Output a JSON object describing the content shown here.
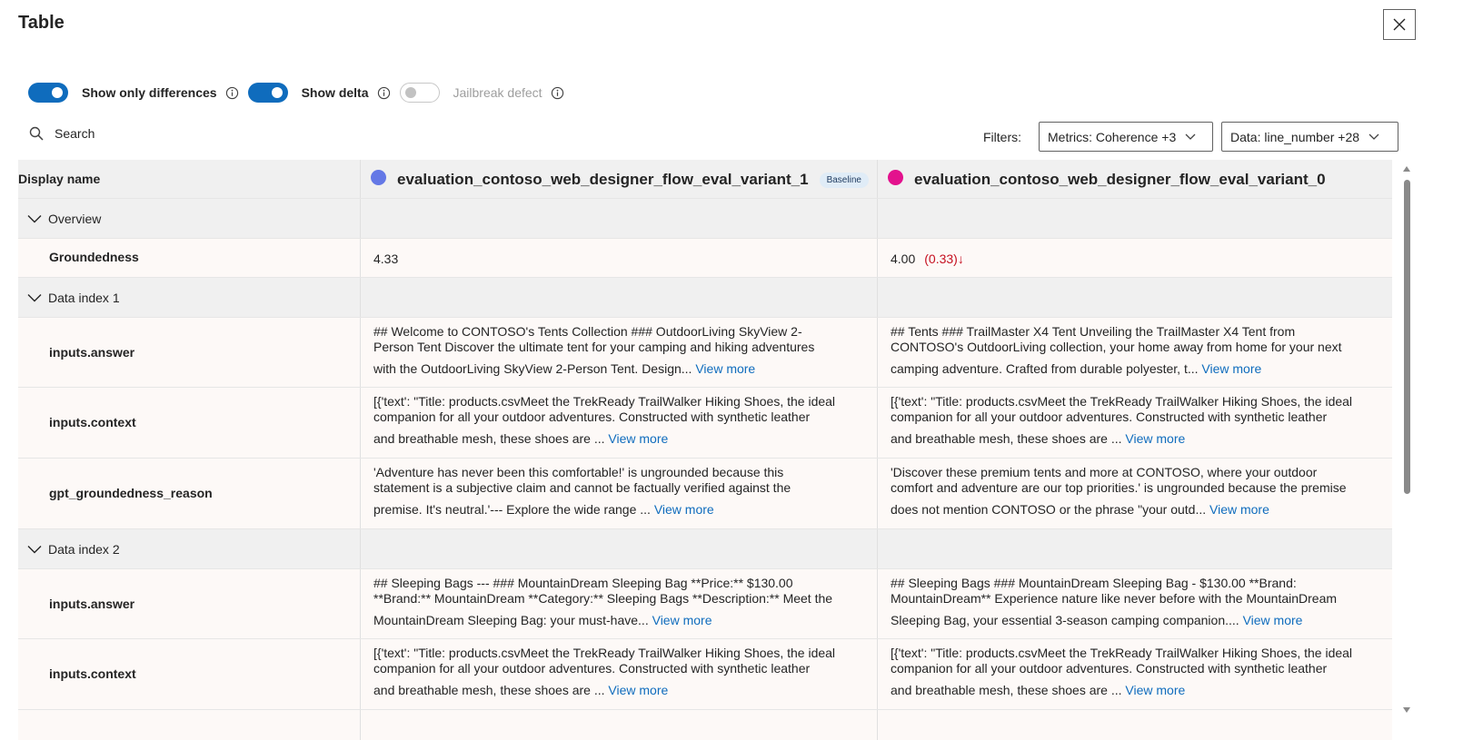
{
  "page": {
    "title": "Table"
  },
  "toggles": [
    {
      "label": "Show only differences",
      "state": "on"
    },
    {
      "label": "Show delta",
      "state": "on"
    },
    {
      "label": "Jailbreak defect",
      "state": "off"
    }
  ],
  "search": {
    "label": "Search"
  },
  "filters": {
    "label": "Filters:",
    "metrics": "Metrics: Coherence +3",
    "data": "Data: line_number +28"
  },
  "table": {
    "display_name_header": "Display name",
    "runs": [
      {
        "name": "evaluation_contoso_web_designer_flow_eval_variant_1",
        "color": "#6478e6",
        "badge": "Baseline"
      },
      {
        "name": "evaluation_contoso_web_designer_flow_eval_variant_0",
        "color": "#e3128d"
      }
    ],
    "view_more": "View more",
    "groups": [
      {
        "label": "Overview"
      },
      {
        "label": "Data index 1"
      },
      {
        "label": "Data index 2"
      }
    ],
    "overview": {
      "metric": "Groundedness",
      "baseline_value": "4.33",
      "variant_value": "4.00",
      "delta": "(0.33)↓"
    },
    "index1": [
      {
        "name": "inputs.answer",
        "c1": [
          "## Welcome to CONTOSO's Tents Collection ### OutdoorLiving SkyView 2-",
          "Person Tent Discover the ultimate tent for your camping and hiking adventures",
          "with the OutdoorLiving SkyView 2-Person Tent. Design..."
        ],
        "c2": [
          "## Tents ### TrailMaster X4 Tent Unveiling the TrailMaster X4 Tent from",
          "CONTOSO's OutdoorLiving collection, your home away from home for your next",
          "camping adventure. Crafted from durable polyester, t..."
        ]
      },
      {
        "name": "inputs.context",
        "c1": [
          "[{'text': \"Title: products.csvMeet the TrekReady TrailWalker Hiking Shoes, the ideal",
          "companion for all your outdoor adventures. Constructed with synthetic leather",
          "and breathable mesh, these shoes are ..."
        ],
        "c2": [
          "[{'text': \"Title: products.csvMeet the TrekReady TrailWalker Hiking Shoes, the ideal",
          "companion for all your outdoor adventures. Constructed with synthetic leather",
          "and breathable mesh, these shoes are ..."
        ]
      },
      {
        "name": "gpt_groundedness_reason",
        "c1": [
          "'Adventure has never been this comfortable!' is ungrounded because this",
          "statement is a subjective claim and cannot be factually verified against the",
          "premise. It's neutral.'--- Explore the wide range ..."
        ],
        "c2": [
          "'Discover these premium tents and more at CONTOSO, where your outdoor",
          "comfort and adventure are our top priorities.' is ungrounded because the premise",
          "does not mention CONTOSO or the phrase \"your outd..."
        ]
      }
    ],
    "index2": [
      {
        "name": "inputs.answer",
        "c1": [
          "## Sleeping Bags --- ### MountainDream Sleeping Bag **Price:** $130.00",
          "**Brand:** MountainDream **Category:** Sleeping Bags **Description:** Meet the",
          "MountainDream Sleeping Bag: your must-have..."
        ],
        "c2": [
          "## Sleeping Bags ### MountainDream Sleeping Bag - $130.00 **Brand:",
          "MountainDream** Experience nature like never before with the MountainDream",
          "Sleeping Bag, your essential 3-season camping companion...."
        ]
      },
      {
        "name": "inputs.context",
        "c1": [
          "[{'text': \"Title: products.csvMeet the TrekReady TrailWalker Hiking Shoes, the ideal",
          "companion for all your outdoor adventures. Constructed with synthetic leather",
          "and breathable mesh, these shoes are ..."
        ],
        "c2": [
          "[{'text': \"Title: products.csvMeet the TrekReady TrailWalker Hiking Shoes, the ideal",
          "companion for all your outdoor adventures. Constructed with synthetic leather",
          "and breathable mesh, these shoes are ..."
        ]
      }
    ]
  }
}
